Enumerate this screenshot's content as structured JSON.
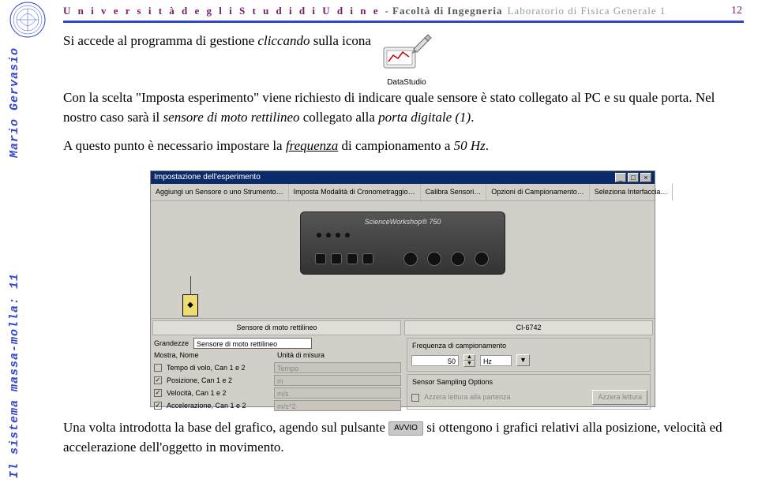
{
  "header": {
    "university": "U n i v e r s i t à   d e g l i   S t u d i   d i   U d i n e",
    "faculty": "- Facoltà di Ingegneria",
    "lab": "Laboratorio di Fisica Generale 1",
    "page_number": "12"
  },
  "sidebar": {
    "author": "Mario Gervasio",
    "course_title": "Il sistema massa-molla: 11"
  },
  "body": {
    "p1_prefix": "Si accede al programma di gestione ",
    "p1_italic": "cliccando",
    "p1_suffix": " sulla icona",
    "ds_caption": "DataStudio",
    "p2_a": "Con la scelta \"Imposta esperimento\" viene richiesto di indicare quale sensore è stato collegato al PC e su quale porta. Nel nostro caso sarà il ",
    "p2_i1": "sensore di moto rettilineo",
    "p2_b": " collegato alla ",
    "p2_i2": "porta digitale (1)",
    "p2_c": ".",
    "p3_a": "A questo punto è necessario impostare la ",
    "p3_i": "frequenza",
    "p3_b": " di campionamento a ",
    "p3_i2": "50 Hz",
    "p3_c": ".",
    "p4_a": "Una volta introdotta la base del grafico, agendo sul pulsante ",
    "p4_btn": "AVVIO",
    "p4_b": " si ottengono i grafici relativi alla posizione, velocità ed accelerazione dell'oggetto in movimento."
  },
  "screenshot": {
    "title": "Impostazione dell'esperimento",
    "win_min": "_",
    "win_max": "□",
    "win_close": "×",
    "toolbar": {
      "b1": "Aggiungi un Sensore o uno Strumento…",
      "b2": "Imposta Modalità di Cronometraggio…",
      "b3": "Calibra Sensori…",
      "b4": "Opzioni di Campionamento…",
      "b5": "Seleziona Interfaccia…"
    },
    "device_label": "ScienceWorkshop® 750",
    "port_sel_icon": "◆",
    "left_panel": {
      "header": "Sensore di moto rettilineo",
      "tab": "Sensore di moto rettilineo",
      "grandezze": "Grandezze",
      "mostra": "Mostra, Nome",
      "unita": "Unità di misura",
      "r1_label": "Tempo di volo, Can 1 e 2",
      "r1_unit": "Tempo",
      "r2_label": "Posizione, Can 1 e 2",
      "r2_unit": "m",
      "r3_label": "Velocità, Can 1 e 2",
      "r3_unit": "m/s",
      "r4_label": "Accelerazione, Can 1 e 2",
      "r4_unit": "m/s^2"
    },
    "right_panel": {
      "model": "CI-6742",
      "freq_label": "Frequenza di campionamento",
      "freq_val": "50",
      "freq_unit": "Hz",
      "opts_label": "Sensor Sampling Options",
      "zero_label": "Azzera lettura alla partenza",
      "zero_btn": "Azzera lettura"
    }
  }
}
